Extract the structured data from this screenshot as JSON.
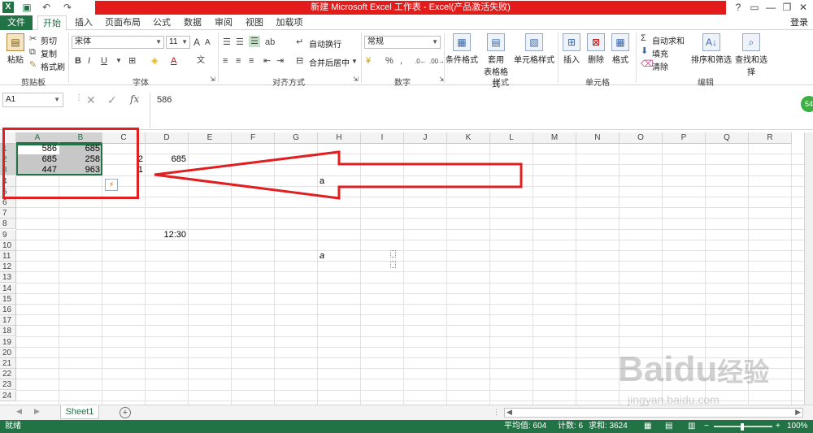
{
  "window": {
    "title": "新建 Microsoft Excel 工作表 - Excel(产品激活失败)",
    "controls": [
      "?",
      "▭",
      "—",
      "❐",
      "✕"
    ]
  },
  "tabs": [
    "文件",
    "开始",
    "插入",
    "页面布局",
    "公式",
    "数据",
    "审阅",
    "视图",
    "加载项"
  ],
  "login": "登录",
  "ribbon": {
    "clipboard": {
      "paste": "粘贴",
      "cut": "剪切",
      "copy": "复制",
      "format_painter": "格式刷",
      "label": "剪贴板"
    },
    "font": {
      "name": "宋体",
      "size": "11",
      "bold": "B",
      "italic": "I",
      "underline": "U",
      "label": "字体"
    },
    "alignment": {
      "wrap": "自动换行",
      "merge": "合并后居中",
      "label": "对齐方式"
    },
    "number": {
      "format": "常规",
      "percent": "%",
      "comma": ",",
      "label": "数字"
    },
    "styles": {
      "conditional": "条件格式",
      "table": "套用",
      "table2": "表格格式",
      "cell_style": "单元格样式",
      "label": "样式"
    },
    "cells": {
      "insert": "插入",
      "delete": "删除",
      "format": "格式",
      "label": "单元格"
    },
    "editing": {
      "autosum": "自动求和",
      "fill": "填充",
      "clear": "清除",
      "sort": "排序和筛选",
      "find": "查找和选择",
      "label": "编辑"
    }
  },
  "formula_bar": {
    "name_box": "A1",
    "fx": "fx",
    "value": "586"
  },
  "badge": "54",
  "columns": [
    "A",
    "B",
    "C",
    "D",
    "E",
    "F",
    "G",
    "H",
    "I",
    "J",
    "K",
    "L",
    "M",
    "N",
    "O",
    "P",
    "Q",
    "R"
  ],
  "rows": [
    "1",
    "2",
    "3",
    "4",
    "5",
    "6",
    "7",
    "8",
    "9",
    "10",
    "11",
    "12",
    "13",
    "14",
    "15",
    "16",
    "17",
    "18",
    "19",
    "20",
    "21",
    "22",
    "23",
    "24"
  ],
  "cells": {
    "A1": "586",
    "B1": "685",
    "A2": "685",
    "B2": "258",
    "A3": "447",
    "B3": "963",
    "C2": "2",
    "C3": "1",
    "D2": "685",
    "D9": "12:30",
    "H4": "a",
    "H11": "a"
  },
  "sheet_tab": "Sheet1",
  "status": {
    "ready": "就绪",
    "average": "平均值: 604",
    "count": "计数: 6",
    "sum": "求和: 3624",
    "zoom": "100%"
  },
  "watermark": {
    "brand": "Baidu",
    "sub": "经验",
    "url": "jingyan.baidu.com"
  }
}
